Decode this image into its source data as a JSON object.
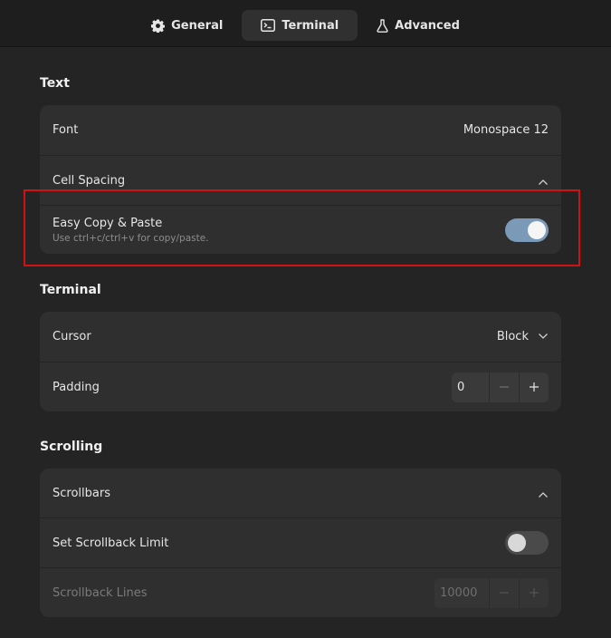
{
  "tabs": [
    {
      "label": "General",
      "icon": "gear-icon",
      "active": false
    },
    {
      "label": "Terminal",
      "icon": "terminal-icon",
      "active": true
    },
    {
      "label": "Advanced",
      "icon": "flask-icon",
      "active": false
    }
  ],
  "text_section": {
    "title": "Text",
    "font_label": "Font",
    "font_value": "Monospace 12",
    "cell_spacing_label": "Cell Spacing",
    "easy_copy_label": "Easy Copy & Paste",
    "easy_copy_sublabel": "Use ctrl+c/ctrl+v for copy/paste.",
    "easy_copy_enabled": true
  },
  "terminal_section": {
    "title": "Terminal",
    "cursor_label": "Cursor",
    "cursor_value": "Block",
    "padding_label": "Padding",
    "padding_value": "0"
  },
  "scrolling_section": {
    "title": "Scrolling",
    "scrollbars_label": "Scrollbars",
    "scrollback_limit_label": "Set Scrollback Limit",
    "scrollback_limit_enabled": false,
    "scrollback_lines_label": "Scrollback Lines",
    "scrollback_lines_value": "10000"
  },
  "colors": {
    "accent_toggle": "#7b9ab8",
    "highlight_box": "#d01212"
  }
}
